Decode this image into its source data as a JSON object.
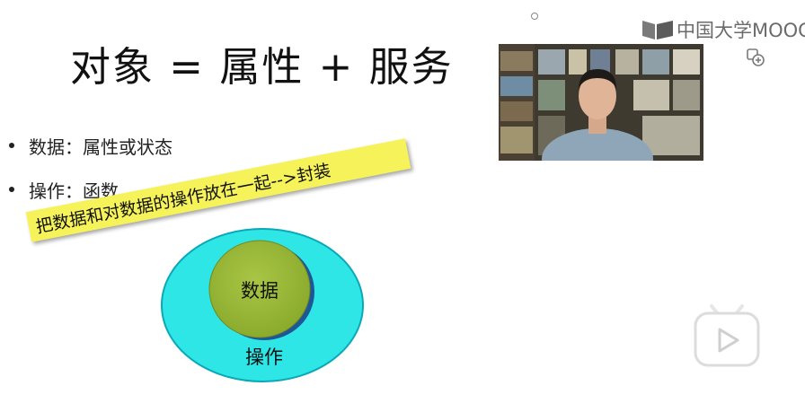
{
  "slide": {
    "title": "对象 = 属性 + 服务",
    "bullets": [
      {
        "label": "数据：属性或状态"
      },
      {
        "label": "操作：函数"
      }
    ],
    "banner_text": "把数据和对数据的操作放在一起-->封装",
    "diagram": {
      "inner_label": "数据",
      "outer_label": "操作",
      "inner_color": "#9dbb3a",
      "outer_color": "#2ee6e6"
    }
  },
  "overlay": {
    "brand_text": "中国大学MOOC",
    "icons": [
      "small-circle-icon",
      "copy-icon",
      "play-icon"
    ],
    "play_button_color": "#ffffff"
  },
  "video": {
    "description_icon": "lecturer-video-thumbnail"
  }
}
